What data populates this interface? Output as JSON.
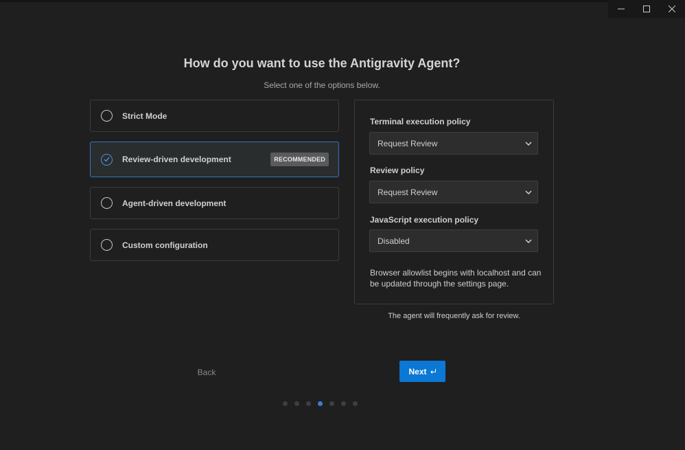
{
  "header": {
    "title": "How do you want to use the Antigravity Agent?",
    "subtitle": "Select one of the options below."
  },
  "options": [
    {
      "label": "Strict Mode",
      "selected": false
    },
    {
      "label": "Review-driven development",
      "selected": true,
      "badge": "RECOMMENDED"
    },
    {
      "label": "Agent-driven development",
      "selected": false
    },
    {
      "label": "Custom configuration",
      "selected": false
    }
  ],
  "panel": {
    "terminal_label": "Terminal execution policy",
    "terminal_value": "Request Review",
    "review_label": "Review policy",
    "review_value": "Request Review",
    "js_label": "JavaScript execution policy",
    "js_value": "Disabled",
    "note": "Browser allowlist begins with localhost and can be updated through the settings page."
  },
  "footnote": "The agent will frequently ask for review.",
  "nav": {
    "back_label": "Back",
    "next_label": "Next",
    "steps_total": 7,
    "step_current": 4
  },
  "colors": {
    "accent": "#0a78d4",
    "selected_border": "#3574c2",
    "background": "#1f1f1f"
  }
}
